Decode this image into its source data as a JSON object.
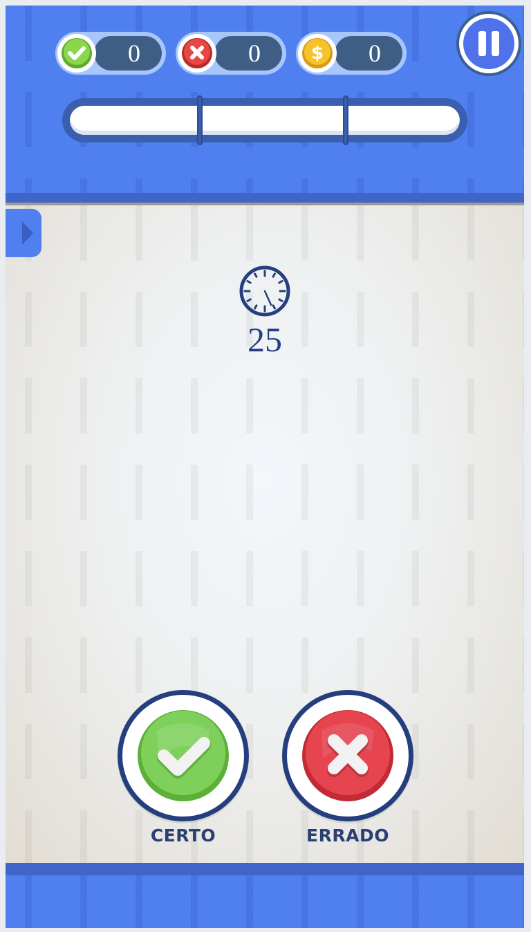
{
  "hud": {
    "correct": {
      "icon": "check-icon",
      "value": "0",
      "color": "#7ccc43"
    },
    "wrong": {
      "icon": "cross-icon",
      "value": "0",
      "color": "#e63b3b"
    },
    "coins": {
      "icon": "dollar-coin-icon",
      "symbol": "$",
      "value": "0",
      "color": "#f2b81a"
    },
    "pause": {
      "icon": "pause-icon"
    },
    "progress": {
      "fraction": 1.0,
      "markers": [
        0.333,
        0.708
      ]
    }
  },
  "side_tab": {
    "icon": "chevron-right-icon"
  },
  "timer": {
    "icon": "clock-icon",
    "seconds": "25"
  },
  "answers": {
    "correct": {
      "icon": "check-icon",
      "label": "CERTO",
      "color": "#7ed05a"
    },
    "wrong": {
      "icon": "cross-icon",
      "label": "ERRADO",
      "color": "#e64550"
    }
  },
  "colors": {
    "primary_blue": "#5080f0",
    "dark_navy": "#253f7e",
    "play_area": "#f1f4f7"
  }
}
